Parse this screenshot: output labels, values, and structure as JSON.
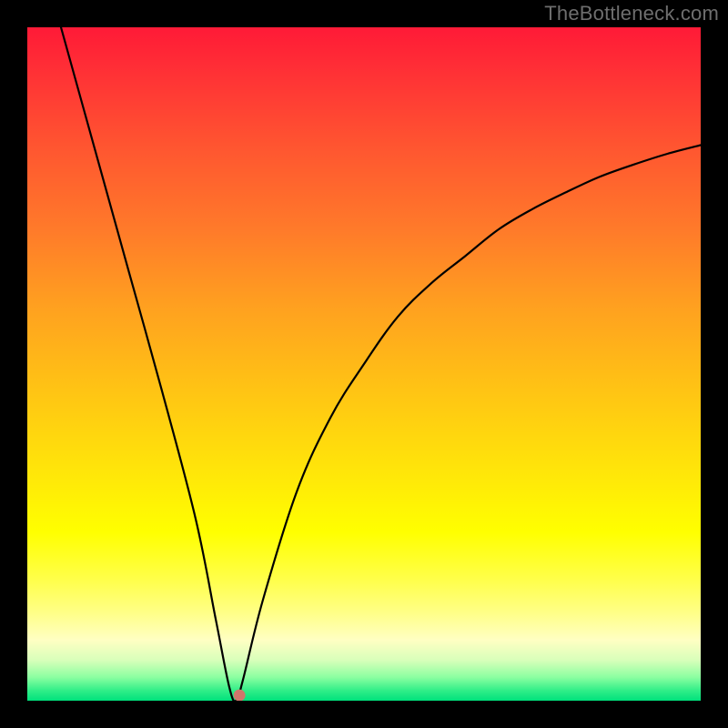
{
  "watermark": "TheBottleneck.com",
  "chart_data": {
    "type": "line",
    "title": "",
    "xlabel": "",
    "ylabel": "",
    "x_range": [
      0,
      100
    ],
    "y_range": [
      0,
      100
    ],
    "minimum_point": {
      "x": 31,
      "y": 0
    },
    "series": [
      {
        "name": "bottleneck-curve",
        "x": [
          5,
          10,
          15,
          20,
          25,
          28,
          30,
          31,
          32,
          35,
          40,
          45,
          50,
          55,
          60,
          65,
          70,
          75,
          80,
          85,
          90,
          95,
          100
        ],
        "y": [
          100,
          82,
          64,
          46,
          27,
          12,
          2,
          0,
          3,
          15,
          31,
          42,
          50,
          57,
          62,
          66,
          70,
          73,
          75.5,
          77.8,
          79.6,
          81.2,
          82.5
        ]
      }
    ],
    "marker": {
      "x": 31.5,
      "y": 0.8,
      "color": "#cf766b",
      "radius_px": 6
    },
    "background_gradient": {
      "stops": [
        {
          "pct": 0,
          "color": "#ff1a37"
        },
        {
          "pct": 50,
          "color": "#ffbf12"
        },
        {
          "pct": 78,
          "color": "#ffff00"
        },
        {
          "pct": 100,
          "color": "#00e17c"
        }
      ]
    }
  }
}
